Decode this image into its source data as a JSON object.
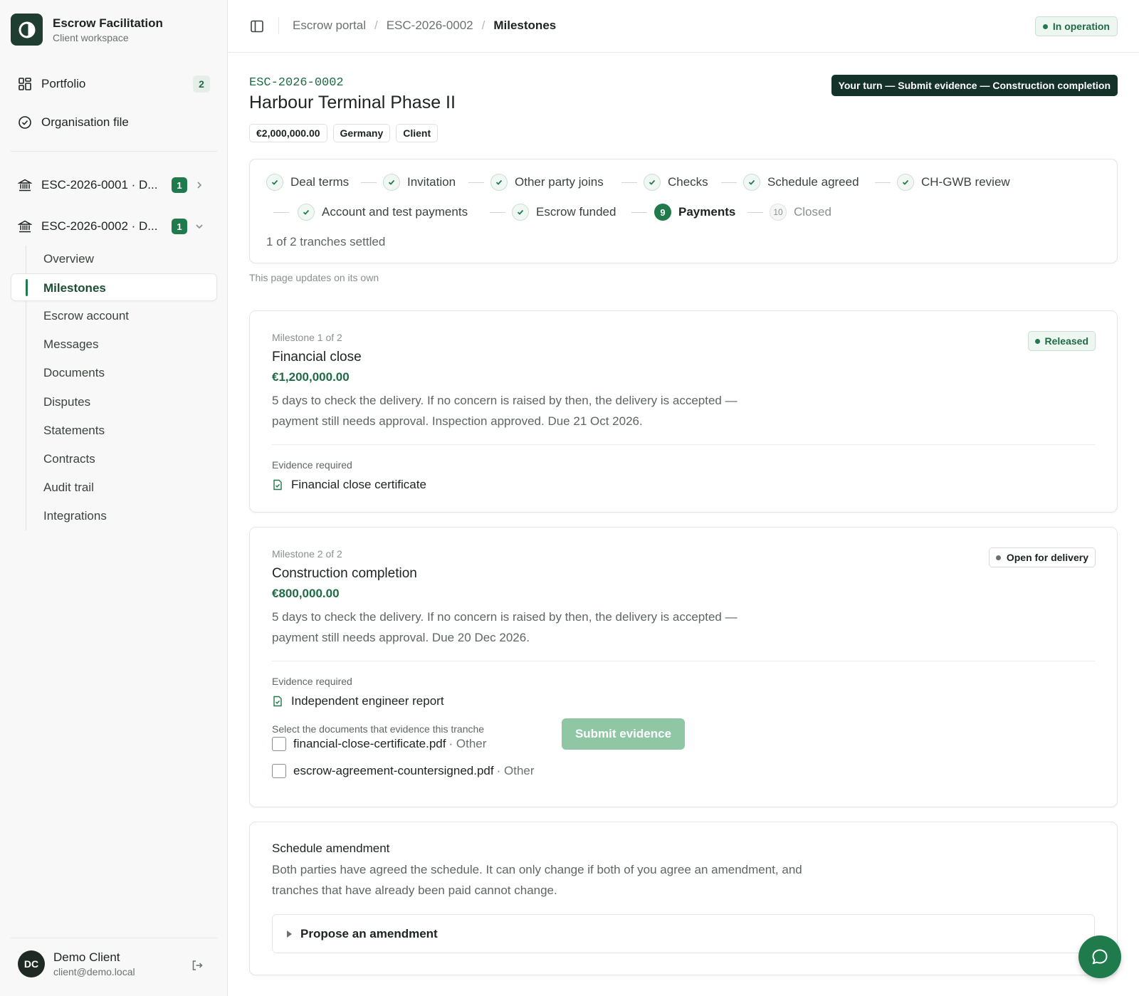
{
  "brand": {
    "title": "Escrow Facilitation",
    "subtitle": "Client workspace"
  },
  "sidebar": {
    "portfolio": {
      "label": "Portfolio",
      "count": "2"
    },
    "org_file": {
      "label": "Organisation file"
    },
    "deals": [
      {
        "label": "ESC-2026-0001 · D...",
        "count": "1"
      },
      {
        "label": "ESC-2026-0002 · D...",
        "count": "1"
      }
    ],
    "subnav": [
      "Overview",
      "Milestones",
      "Escrow account",
      "Messages",
      "Documents",
      "Disputes",
      "Statements",
      "Contracts",
      "Audit trail",
      "Integrations"
    ]
  },
  "user": {
    "initials": "DC",
    "name": "Demo Client",
    "email": "client@demo.local"
  },
  "breadcrumb": [
    "Escrow portal",
    "ESC-2026-0002",
    "Milestones"
  ],
  "status": "In operation",
  "deal": {
    "code": "ESC-2026-0002",
    "name": "Harbour Terminal Phase II",
    "chips": [
      "€2,000,000.00",
      "Germany",
      "Client"
    ],
    "your_turn": "Your turn — Submit evidence — Construction completion"
  },
  "steps": {
    "items": [
      {
        "label": "Deal terms",
        "state": "done"
      },
      {
        "label": "Invitation",
        "state": "done"
      },
      {
        "label": "Other party joins",
        "state": "done"
      },
      {
        "label": "Checks",
        "state": "done"
      },
      {
        "label": "Schedule agreed",
        "state": "done"
      },
      {
        "label": "CH-GWB review",
        "state": "done"
      },
      {
        "label": "Account and test payments",
        "state": "done"
      },
      {
        "label": "Escrow funded",
        "state": "done"
      },
      {
        "label": "Payments",
        "state": "current",
        "number": "9"
      },
      {
        "label": "Closed",
        "state": "upcoming",
        "number": "10"
      }
    ],
    "tranches": "1 of 2 tranches settled"
  },
  "updates_note": "This page updates on its own",
  "milestones": [
    {
      "label": "Milestone 1 of 2",
      "title": "Financial close",
      "amount": "€1,200,000.00",
      "desc_line1": "5 days to check the delivery. If no concern is raised by then, the delivery is accepted —",
      "desc_line2": "payment still needs approval. Inspection approved. Due 21 Oct 2026.",
      "status": "Released",
      "evidence_label": "Evidence required",
      "evidence": "Financial close certificate"
    },
    {
      "label": "Milestone 2 of 2",
      "title": "Construction completion",
      "amount": "€800,000.00",
      "desc_line1": "5 days to check the delivery. If no concern is raised by then, the delivery is accepted —",
      "desc_line2": "payment still needs approval. Due 20 Dec 2026.",
      "status": "Open for delivery",
      "evidence_label": "Evidence required",
      "evidence": "Independent engineer report",
      "select_label": "Select the documents that evidence this tranche",
      "files": [
        {
          "name": "financial-close-certificate.pdf",
          "kind": "· Other"
        },
        {
          "name": "escrow-agreement-countersigned.pdf",
          "kind": "· Other"
        }
      ],
      "submit_label": "Submit evidence"
    }
  ],
  "amendment": {
    "title": "Schedule amendment",
    "line1": "Both parties have agreed the schedule. It can only change if both of you agree an amendment, and",
    "line2": "tranches that have already been paid cannot change.",
    "propose": "Propose an amendment"
  },
  "colors": {
    "accent": "#1f7a4c",
    "dark": "#14322a",
    "disabled_button": "#8fc7a5"
  }
}
